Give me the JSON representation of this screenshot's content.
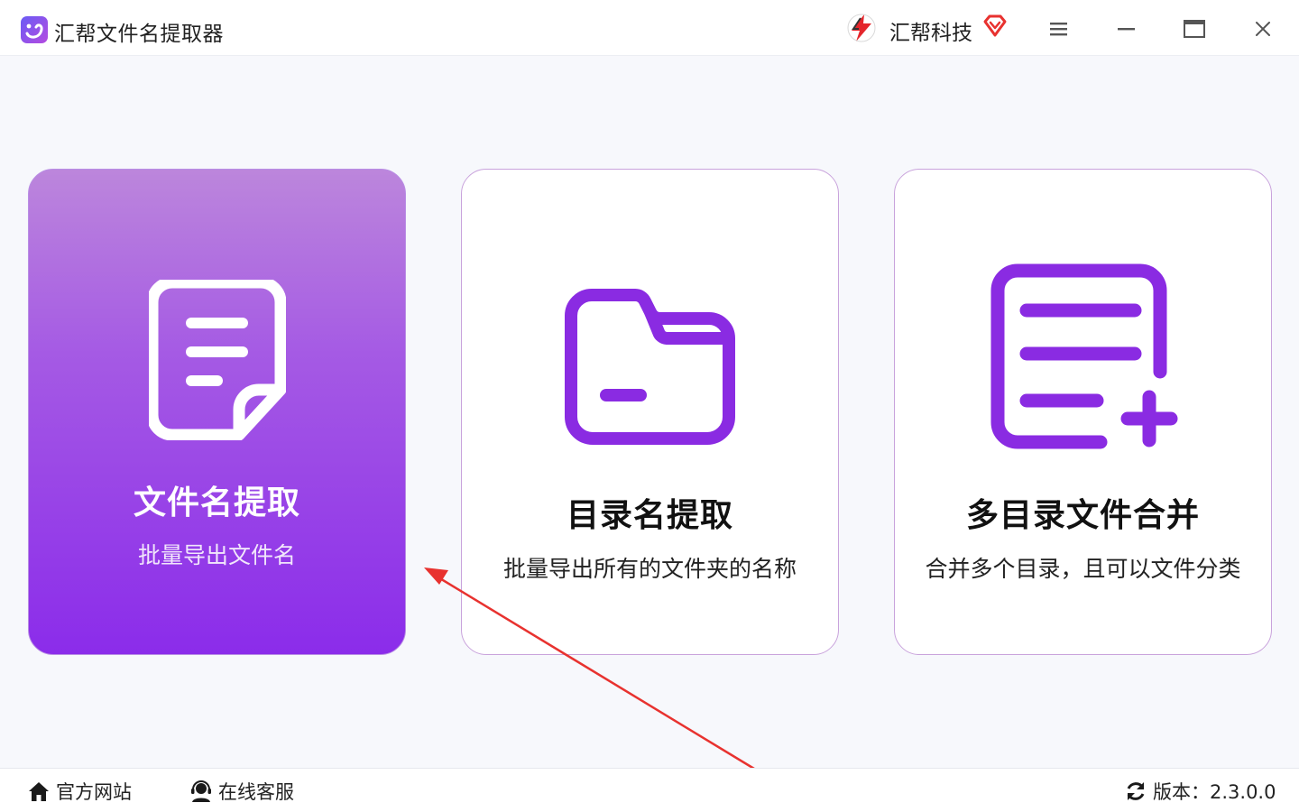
{
  "window": {
    "title": "汇帮文件名提取器",
    "brand": "汇帮科技"
  },
  "icons": {
    "app": "app-logo-icon",
    "brand": "brand-logo-icon",
    "vip": "diamond-vip-icon",
    "menu": "hamburger-menu-icon",
    "minimize": "minimize-icon",
    "maximize": "maximize-icon",
    "close": "close-icon"
  },
  "cards": [
    {
      "title": "文件名提取",
      "subtitle": "批量导出文件名",
      "icon": "document-icon",
      "selected": true
    },
    {
      "title": "目录名提取",
      "subtitle": "批量导出所有的文件夹的名称",
      "icon": "folder-icon",
      "selected": false
    },
    {
      "title": "多目录文件合并",
      "subtitle": "合并多个目录，且可以文件分类",
      "icon": "list-add-icon",
      "selected": false
    }
  ],
  "footer": {
    "official_site": "官方网站",
    "online_service": "在线客服",
    "version": "版本：2.3.0.0"
  },
  "colors": {
    "accent": "#8a2be2",
    "card_gradient_top": "#bc86dc",
    "card_gradient_bottom": "#8b2cea",
    "annotation_arrow": "#e8322f"
  }
}
